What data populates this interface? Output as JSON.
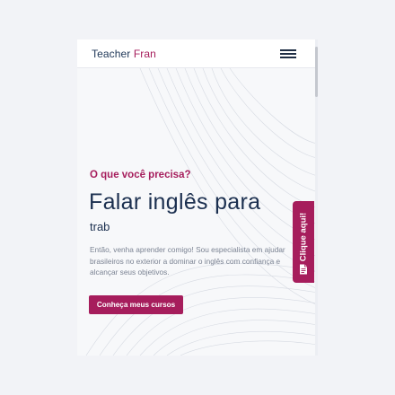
{
  "header": {
    "logo_part1": "Teacher ",
    "logo_part2": "Fran",
    "menu_icon": "hamburger-menu-icon"
  },
  "hero": {
    "kicker": "O que você precisa?",
    "headline": "Falar inglês para",
    "typed_text": "trab",
    "description": "Então, venha aprender comigo! Sou especialista em ajudar brasileiros no exterior a dominar o inglês com confiança e alcançar seus objetivos.",
    "cta_label": "Conheça meus cursos"
  },
  "side_tab": {
    "label": "Clique aqui!",
    "icon": "document-icon"
  },
  "colors": {
    "brand": "#a61d5c",
    "navy": "#1b2f4f",
    "background": "#f2f3f7"
  }
}
